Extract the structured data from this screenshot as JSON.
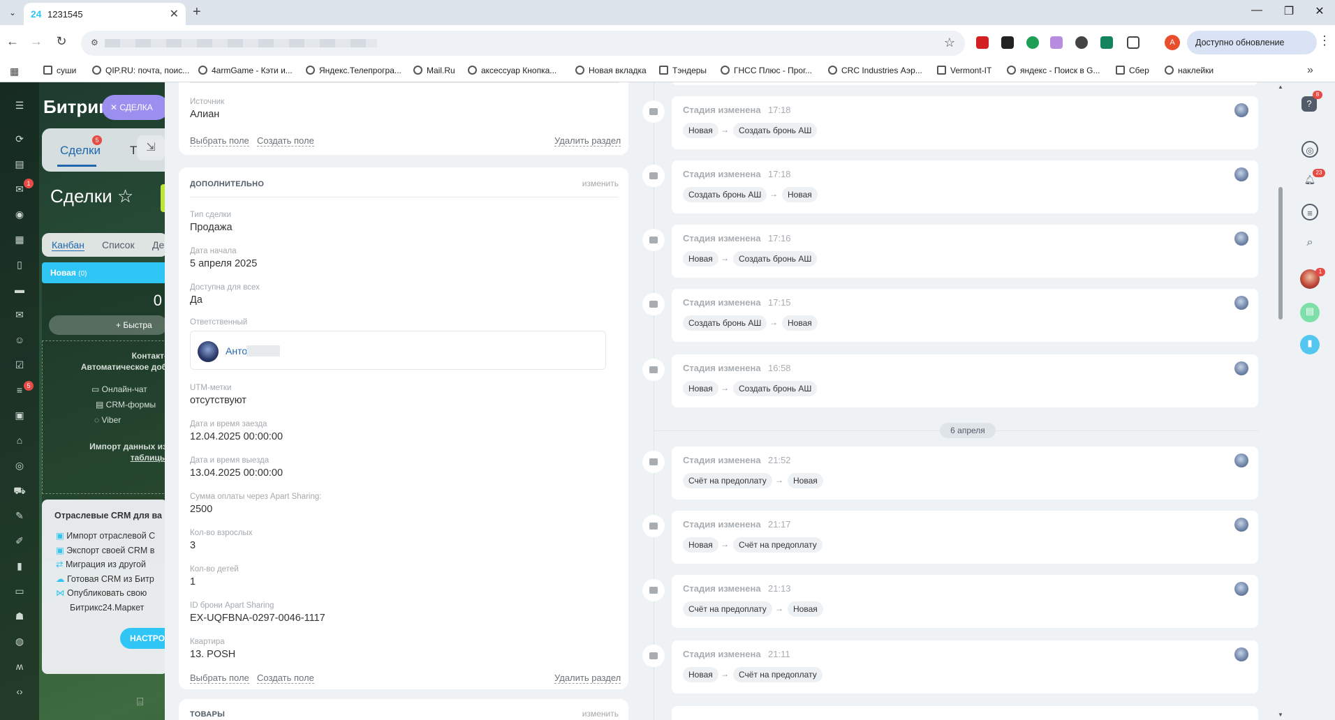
{
  "browser": {
    "tab_favicon": "24",
    "tab_title": "1231545",
    "update_label": "Доступно обновление Chrome",
    "profile_initial": "A",
    "bookmarks": [
      "суши",
      "QIP.RU: почта, поис...",
      "4armGame - Кэти и...",
      "Яндекс.Телепрогра...",
      "Mail.Ru",
      "аксессуар Кнопка...",
      "Новая вкладка",
      "Тэндеры",
      "ГНСС Плюс - Прог...",
      "CRC Industries Аэр...",
      "Vermont-IT",
      "яндекс - Поиск в G...",
      "Сбер",
      "наклейки"
    ]
  },
  "bitrix": {
    "brand": "Битрикс",
    "deal_chip": "СДЕЛКА",
    "tab_deals": "Сделки",
    "tab_deals_badge": "5",
    "tab_other": "Т",
    "deals_title": "Сделки",
    "view_kanban": "Канбан",
    "view_list": "Список",
    "view_other": "Де",
    "column_new": "Новая",
    "column_new_count": "(0)",
    "column_zero": "0",
    "quick_add": "+ Быстра",
    "empty_contact": "Контакт-",
    "empty_auto": "Автоматическое доб",
    "chan_online": "Онлайн-чат",
    "chan_crm_forms": "CRM-формы",
    "chan_viber": "Viber",
    "import_text": "Импорт данных из",
    "import_link": "таблицы",
    "industry_title": "Отраслевые CRM для ва",
    "industry_items": [
      "Импорт отраслевой С",
      "Экспорт своей CRM в",
      "Миграция из другой",
      "Готовая CRM из Битр",
      "Опубликовать свою",
      "Битрикс24.Маркет"
    ],
    "industry_button": "НАСТРО",
    "left_badges": [
      "1",
      "5"
    ]
  },
  "main_section": {
    "source_label": "Источник",
    "source_value": "Алиан",
    "select_field": "Выбрать поле",
    "create_field": "Создать поле",
    "delete_section": "Удалить раздел"
  },
  "additional": {
    "title": "ДОПОЛНИТЕЛЬНО",
    "edit": "изменить",
    "fields": [
      {
        "label": "Тип сделки",
        "value": "Продажа"
      },
      {
        "label": "Дата начала",
        "value": "5 апреля 2025"
      },
      {
        "label": "Доступна для всех",
        "value": "Да"
      }
    ],
    "responsible_label": "Ответственный",
    "responsible_name": "Антон",
    "fields2": [
      {
        "label": "UTM-метки",
        "value": "отсутствуют"
      },
      {
        "label": "Дата и время заезда",
        "value": "12.04.2025 00:00:00"
      },
      {
        "label": "Дата и время выезда",
        "value": "13.04.2025 00:00:00"
      },
      {
        "label": "Сумма оплаты через Apart Sharing:",
        "value": "2500"
      },
      {
        "label": "Кол-во взрослых",
        "value": "3"
      },
      {
        "label": "Кол-во детей",
        "value": "1"
      },
      {
        "label": "ID брони Apart Sharing",
        "value": "EX-UQFBNA-0297-0046-1117"
      },
      {
        "label": "Квартира",
        "value": "13. POSH"
      }
    ],
    "select_field": "Выбрать поле",
    "create_field": "Создать поле",
    "delete_section": "Удалить раздел"
  },
  "products": {
    "title": "ТОВАРЫ",
    "edit": "изменить"
  },
  "timeline": {
    "date_separator": "6 апреля",
    "events": [
      {
        "title": "Стадия изменена",
        "time": "17:18",
        "from": "Новая",
        "to": "Создать бронь АШ"
      },
      {
        "title": "Стадия изменена",
        "time": "17:18",
        "from": "Создать бронь АШ",
        "to": "Новая"
      },
      {
        "title": "Стадия изменена",
        "time": "17:16",
        "from": "Новая",
        "to": "Создать бронь АШ"
      },
      {
        "title": "Стадия изменена",
        "time": "17:15",
        "from": "Создать бронь АШ",
        "to": "Новая"
      },
      {
        "title": "Стадия изменена",
        "time": "16:58",
        "from": "Новая",
        "to": "Создать бронь АШ"
      },
      {
        "title": "Стадия изменена",
        "time": "21:52",
        "from": "Счёт на предоплату",
        "to": "Новая"
      },
      {
        "title": "Стадия изменена",
        "time": "21:17",
        "from": "Новая",
        "to": "Счёт на предоплату"
      },
      {
        "title": "Стадия изменена",
        "time": "21:13",
        "from": "Счёт на предоплату",
        "to": "Новая"
      },
      {
        "title": "Стадия изменена",
        "time": "21:11",
        "from": "Новая",
        "to": "Счёт на предоплату"
      }
    ],
    "arrow": "→"
  },
  "rail": {
    "help_badge": "8",
    "notif_badge": "23",
    "avatar_badge": "1"
  },
  "colors": {
    "accent": "#2fc6f6",
    "link": "#2067b0",
    "badge": "#e64b45",
    "chip": "#9b8ff0"
  }
}
